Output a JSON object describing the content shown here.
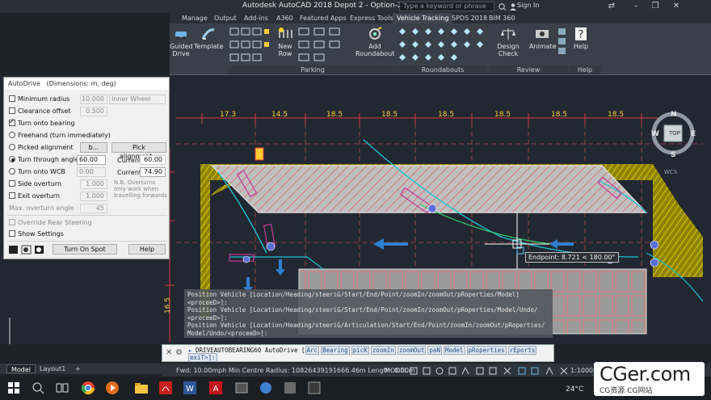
{
  "window": {
    "title": "Autodesk AutoCAD 2018    Depot 2 - Option-2.dwg",
    "search_placeholder": "Type a keyword or phrase",
    "sign_in": "Sign In"
  },
  "ribbon": {
    "tabs": [
      "Manage",
      "Output",
      "Add-ins",
      "A360",
      "Featured Apps",
      "Express Tools",
      "Vehicle Tracking",
      "SPDS 2018",
      "BIM 360"
    ],
    "active_tab": "Vehicle Tracking",
    "buttons": {
      "guided_drive": "Guided\nDrive",
      "template": "Template",
      "new_row": "New\nRow",
      "add_roundabout": "Add\nRoundabout",
      "design_check": "Design Check",
      "animate": "Animate",
      "help": "Help"
    },
    "panels": [
      "Parking",
      "Roundabouts",
      "Review",
      "Help"
    ]
  },
  "autodrive": {
    "title": "AutoDrive",
    "subtitle": "(Dimensions: m, deg)",
    "minimum_radius_label": "Minimum radius",
    "minimum_radius_value": "10.000",
    "wheel_select": "Inner Wheel",
    "clearance_offset_label": "Clearance offset",
    "clearance_offset_value": "0.500",
    "turn_onto_bearing_label": "Turn onto bearing",
    "freehand_label": "Freehand (turn immediately)",
    "picked_alignment_label": "Picked alignment",
    "picked_btn": "b...",
    "pick_alignment_btn": "Pick alignment...",
    "turn_through_angle_label": "Turn through angle",
    "turn_through_angle_value": "60.00",
    "current_label": "Current",
    "current_value_1": "60.00",
    "turn_onto_wcb_label": "Turn onto WCB",
    "turn_onto_wcb_value": "0.00",
    "current_value_2": "74.90",
    "side_overturn_label": "Side overturn",
    "side_overturn_value": "1.000",
    "exit_overturn_label": "Exit overturn",
    "exit_overturn_value": "1.000",
    "max_overturn_label": "Max. overturn angle",
    "max_overturn_value": "45",
    "note": "N.B. Overturns only work when travelling forwards",
    "override_rear_label": "Override Rear Steering",
    "show_settings_label": "Show Settings",
    "turn_on_spot_btn": "Turn On Spot",
    "help_btn": "Help"
  },
  "drawing": {
    "dimensions_top": [
      "17.3",
      "14.5",
      "18.5",
      "18.5",
      "18.5",
      "18.5",
      "18.5",
      "18.5"
    ],
    "dimensions_left": [
      "16.0",
      "16.5",
      "16.5"
    ],
    "tooltip": "Endpoint: 8.721 < 180.00°",
    "viewcube": {
      "top": "TOP",
      "n": "N",
      "s": "S",
      "e": "E",
      "w": "W",
      "wcs": "WCS"
    }
  },
  "command": {
    "history": [
      "Position Vehicle [Location/Heading/steeriG/Start/End/Point/zoomIn/zoomOut/pRoperties/Model]",
      "<proceeD>]:",
      "Position Vehicle [Location/Heading/steeriG/Start/End/Point/zoomIn/zoomOut/pRoperties/Model/Undo/",
      "<proceeD>]:",
      "Position Vehicle [Location/Heading/steeriG/Articulation/Start/End/Point/zoomIn/zoomOut/pRoperties/",
      "Model/Undo/<proceeD>]:"
    ],
    "prompt": "DRIVEAUTOBEARING60 AutoDrive",
    "options": [
      "Arc",
      "Bearing",
      "picK",
      "zoomIn",
      "zoomOut",
      "paN",
      "Model",
      "pRoperties",
      "rEports"
    ],
    "exit": "exiT>]:"
  },
  "layout_tabs": [
    "Model",
    "Layout1",
    "+"
  ],
  "status": {
    "text": "Fwd: 10.00mph Min Centre Radius: 10826439191666.46m Length: 0.00m",
    "model": "MODEL",
    "scale": "1:1000"
  },
  "taskbar": {
    "weather": "24°C"
  },
  "watermark": {
    "brand": "CGer.com",
    "sub": "CG资源  CG网站"
  },
  "colors": {
    "accent": "#2f7fd0",
    "hatch_yellow": "#c8b400",
    "vehicle_cyan": "#19c2d6",
    "vehicle_magenta": "#c23a9c",
    "green_path": "#2ecc71",
    "dim_red": "#d23b3b"
  }
}
